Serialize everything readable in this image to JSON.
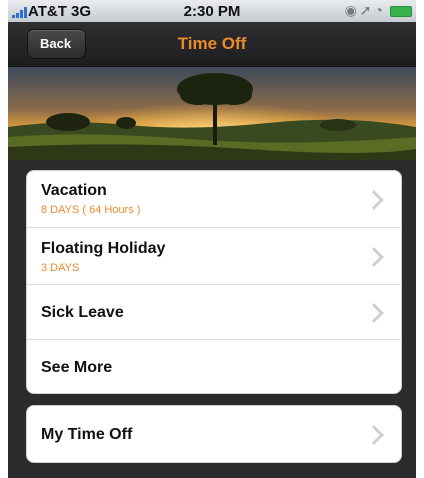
{
  "status": {
    "carrier": "AT&T 3G",
    "time": "2:30 PM"
  },
  "nav": {
    "back_label": "Back",
    "title": "Time Off"
  },
  "menu": [
    {
      "label": "Vacation",
      "detail": "8 DAYS ( 64 Hours )"
    },
    {
      "label": "Floating Holiday",
      "detail": "3 DAYS"
    },
    {
      "label": "Sick Leave",
      "detail": ""
    },
    {
      "label": "See More",
      "detail": ""
    }
  ],
  "secondary": {
    "label": "My Time Off"
  },
  "colors": {
    "accent": "#ec8a2a",
    "nav_bg": "#1d1d1f"
  }
}
